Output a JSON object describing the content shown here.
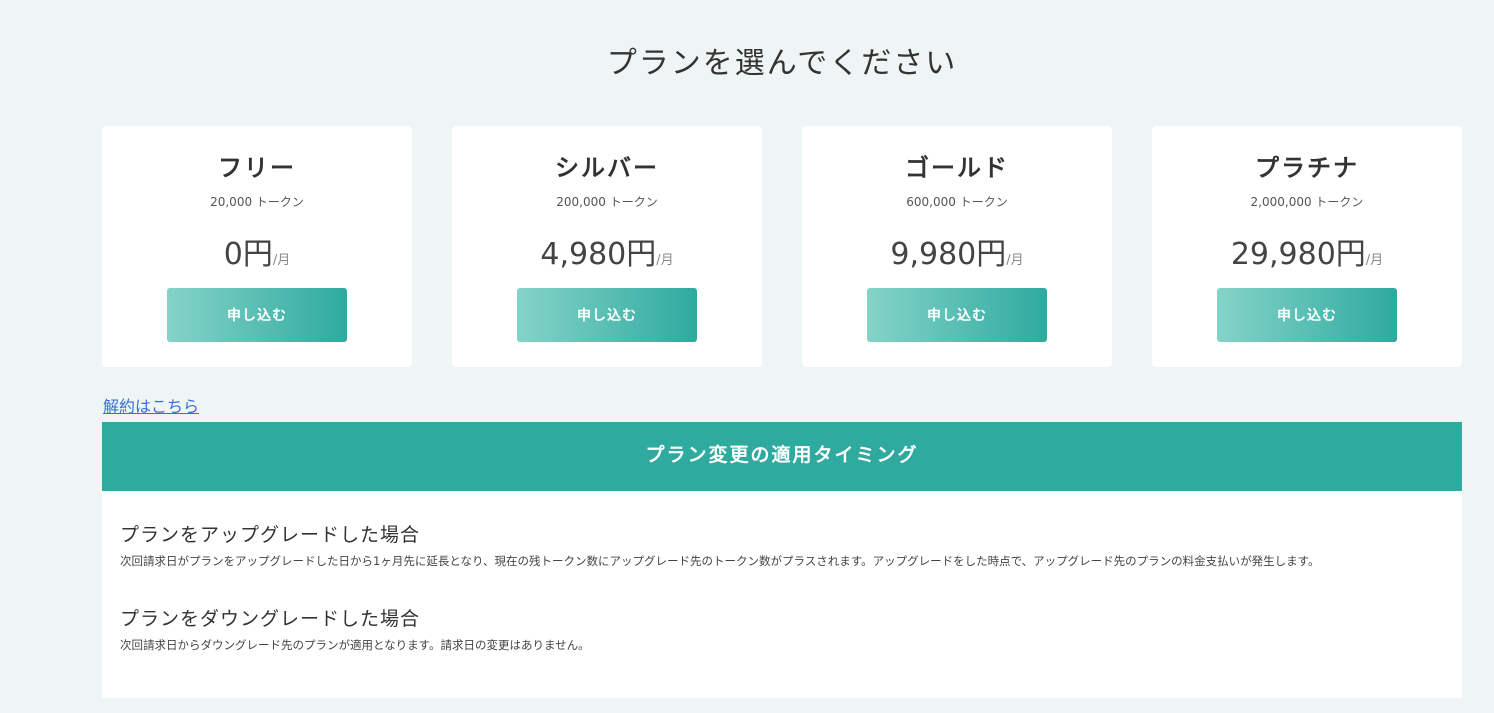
{
  "page": {
    "title": "プランを選んでください"
  },
  "plans": [
    {
      "name": "フリー",
      "tokens": "20,000 トークン",
      "price": "0円",
      "unit": "/月",
      "button_label": "申し込む"
    },
    {
      "name": "シルバー",
      "tokens": "200,000 トークン",
      "price": "4,980円",
      "unit": "/月",
      "button_label": "申し込む"
    },
    {
      "name": "ゴールド",
      "tokens": "600,000 トークン",
      "price": "9,980円",
      "unit": "/月",
      "button_label": "申し込む"
    },
    {
      "name": "プラチナ",
      "tokens": "2,000,000 トークン",
      "price": "29,980円",
      "unit": "/月",
      "button_label": "申し込む"
    }
  ],
  "cancel_link": "解約はこちら",
  "timing": {
    "header": "プラン変更の適用タイミング",
    "upgrade": {
      "heading": "プランをアップグレードした場合",
      "description": "次回請求日がプランをアップグレードした日から1ヶ月先に延長となり、現在の残トークン数にアップグレード先のトークン数がプラスされます。アップグレードをした時点で、アップグレード先のプランの料金支払いが発生します。"
    },
    "downgrade": {
      "heading": "プランをダウングレードした場合",
      "description": "次回請求日からダウングレード先のプランが適用となります。請求日の変更はありません。"
    }
  },
  "colors": {
    "accent": "#2eaa9f",
    "accent_light": "#85d3c8",
    "background": "#eef5f4",
    "link": "#3a6fd8"
  }
}
